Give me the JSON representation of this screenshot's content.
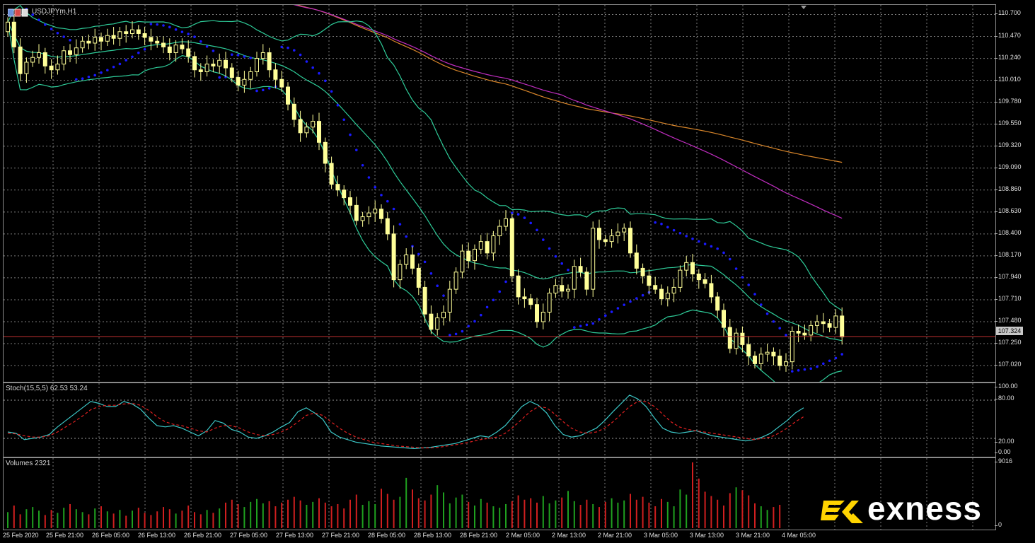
{
  "window": {
    "symbol_label": "USDJPYm,H1"
  },
  "stoch_label": "Stoch(15,5,5) 62.53 53.24",
  "volume_label": "Volumes 2321",
  "current_price": "107.324",
  "price_ticks": [
    "110.700",
    "110.470",
    "110.240",
    "110.010",
    "109.780",
    "109.550",
    "109.320",
    "109.090",
    "108.860",
    "108.630",
    "108.400",
    "108.170",
    "107.940",
    "107.710",
    "107.480",
    "107.250",
    "107.020"
  ],
  "stoch_ticks": [
    "100.00",
    "80.00",
    "20.00",
    "0.00"
  ],
  "volume_ticks": [
    "9016",
    "0"
  ],
  "time_ticks": [
    "25 Feb 2020",
    "25 Feb 21:00",
    "26 Feb 05:00",
    "26 Feb 13:00",
    "26 Feb 21:00",
    "27 Feb 05:00",
    "27 Feb 13:00",
    "27 Feb 21:00",
    "28 Feb 05:00",
    "28 Feb 13:00",
    "28 Feb 21:00",
    "2 Mar 05:00",
    "2 Mar 13:00",
    "2 Mar 21:00",
    "3 Mar 05:00",
    "3 Mar 13:00",
    "3 Mar 21:00",
    "4 Mar 05:00"
  ],
  "logo_text": "exness",
  "colors": {
    "bull_candle": "#ffff99",
    "bear_candle": "#ffff99",
    "sar": "#1a1aff",
    "bands": "#2ecc99",
    "ma_long": "#d9862a",
    "ma_mid": "#c02dc0",
    "stoch_main": "#3cc8c8",
    "stoch_signal": "#e02020",
    "vol_up": "#1fa01f",
    "vol_down": "#d01f1f",
    "price_line": "#c03030",
    "logo_accent": "#ffd400"
  },
  "chart_data": [
    {
      "type": "candlestick",
      "title": "USDJPYm,H1",
      "ylim": [
        106.85,
        110.8
      ],
      "close": [
        110.62,
        110.36,
        110.08,
        110.2,
        110.25,
        110.3,
        110.16,
        110.12,
        110.18,
        110.32,
        110.28,
        110.35,
        110.42,
        110.4,
        110.46,
        110.42,
        110.48,
        110.45,
        110.52,
        110.5,
        110.54,
        110.5,
        110.46,
        110.42,
        110.4,
        110.36,
        110.3,
        110.38,
        110.34,
        110.26,
        110.12,
        110.1,
        110.18,
        110.16,
        110.22,
        110.14,
        110.04,
        109.96,
        110.02,
        110.1,
        110.24,
        110.3,
        110.12,
        110.02,
        109.94,
        109.76,
        109.6,
        109.46,
        109.52,
        109.58,
        109.36,
        109.14,
        108.92,
        108.86,
        108.78,
        108.7,
        108.54,
        108.58,
        108.62,
        108.66,
        108.56,
        108.4,
        107.92,
        108.08,
        108.18,
        108.04,
        107.84,
        107.56,
        107.4,
        107.52,
        107.58,
        107.82,
        108.0,
        108.22,
        108.12,
        108.24,
        108.32,
        108.2,
        108.38,
        108.48,
        108.56,
        107.96,
        107.74,
        107.72,
        107.66,
        107.48,
        107.58,
        107.78,
        107.86,
        107.8,
        107.82,
        108.06,
        108.0,
        107.82,
        108.46,
        108.34,
        108.32,
        108.38,
        108.42,
        108.46,
        108.2,
        108.04,
        107.96,
        107.86,
        107.82,
        107.72,
        107.78,
        107.84,
        108.02,
        108.1,
        107.98,
        107.92,
        107.88,
        107.74,
        107.6,
        107.42,
        107.2,
        107.36,
        107.24,
        107.12,
        107.04,
        107.14,
        107.16,
        107.12,
        107.02,
        107.06,
        107.38,
        107.36,
        107.34,
        107.44,
        107.48,
        107.46,
        107.42,
        107.54,
        107.32
      ]
    },
    {
      "type": "line",
      "title": "Stoch(15,5,5) 62.53 53.24",
      "ylim": [
        0,
        100
      ],
      "series": [
        {
          "values": [
            30,
            28,
            18,
            20,
            22,
            26,
            38,
            48,
            58,
            68,
            78,
            75,
            70,
            70,
            78,
            74,
            66,
            52,
            40,
            38,
            40,
            36,
            30,
            24,
            32,
            48,
            44,
            34,
            30,
            22,
            20,
            24,
            30,
            38,
            45,
            62,
            68,
            60,
            50,
            30,
            22,
            18,
            14,
            12,
            10,
            8,
            7,
            6,
            5,
            4,
            5,
            6,
            8,
            10,
            12,
            16,
            20,
            24,
            22,
            30,
            40,
            55,
            70,
            78,
            72,
            60,
            40,
            26,
            22,
            24,
            30,
            36,
            48,
            62,
            75,
            88,
            82,
            70,
            52,
            36,
            30,
            28,
            30,
            32,
            28,
            24,
            22,
            20,
            18,
            16,
            18,
            22,
            28,
            38,
            48,
            60,
            68
          ]
        },
        {
          "values": [
            28,
            27,
            24,
            22,
            22,
            24,
            30,
            38,
            46,
            55,
            65,
            70,
            72,
            72,
            74,
            75,
            72,
            64,
            54,
            46,
            42,
            40,
            36,
            32,
            30,
            36,
            40,
            40,
            36,
            30,
            26,
            24,
            26,
            30,
            36,
            46,
            56,
            60,
            56,
            46,
            36,
            28,
            22,
            18,
            14,
            12,
            10,
            8,
            7,
            6,
            5,
            5,
            6,
            8,
            10,
            12,
            15,
            18,
            20,
            22,
            28,
            38,
            50,
            62,
            70,
            68,
            58,
            46,
            36,
            30,
            28,
            30,
            36,
            46,
            58,
            70,
            78,
            78,
            70,
            58,
            46,
            38,
            34,
            32,
            30,
            28,
            26,
            24,
            22,
            20,
            18,
            20,
            22,
            28,
            36,
            46,
            54
          ]
        }
      ]
    },
    {
      "type": "bar",
      "title": "Volumes 2321",
      "ylim": [
        0,
        9016
      ],
      "values": [
        2200,
        3100,
        1900,
        2600,
        2900,
        2400,
        1800,
        2500,
        2100,
        2800,
        3300,
        2600,
        2200,
        1900,
        2700,
        3000,
        2300,
        2000,
        2500,
        1700,
        2400,
        2800,
        2100,
        1800,
        2300,
        2900,
        2600,
        2000,
        2400,
        3100,
        2200,
        1900,
        2500,
        2100,
        2700,
        3500,
        3900,
        3300,
        2900,
        3600,
        4000,
        3400,
        3700,
        3000,
        3500,
        3900,
        4300,
        3800,
        3200,
        3600,
        4100,
        3500,
        3000,
        3300,
        2700,
        3900,
        4600,
        3200,
        3700,
        3300,
        5400,
        4700,
        3900,
        4300,
        6900,
        5300,
        4100,
        3800,
        4600,
        5900,
        4900,
        3400,
        4200,
        4600,
        3600,
        3100,
        4000,
        3500,
        3000,
        2800,
        3300,
        3700,
        4500,
        3900,
        4100,
        3500,
        4400,
        3400,
        3800,
        4200,
        5100,
        3700,
        3200,
        3900,
        3300,
        2900,
        3600,
        4100,
        3500,
        3800,
        4700,
        3900,
        4300,
        3500,
        3000,
        4000,
        3600,
        3000,
        5300,
        4600,
        9016,
        6800,
        5000,
        4400,
        3900,
        3100,
        4800,
        5600,
        5200,
        4500,
        3400,
        3000,
        2500,
        2900,
        3200
      ]
    }
  ]
}
